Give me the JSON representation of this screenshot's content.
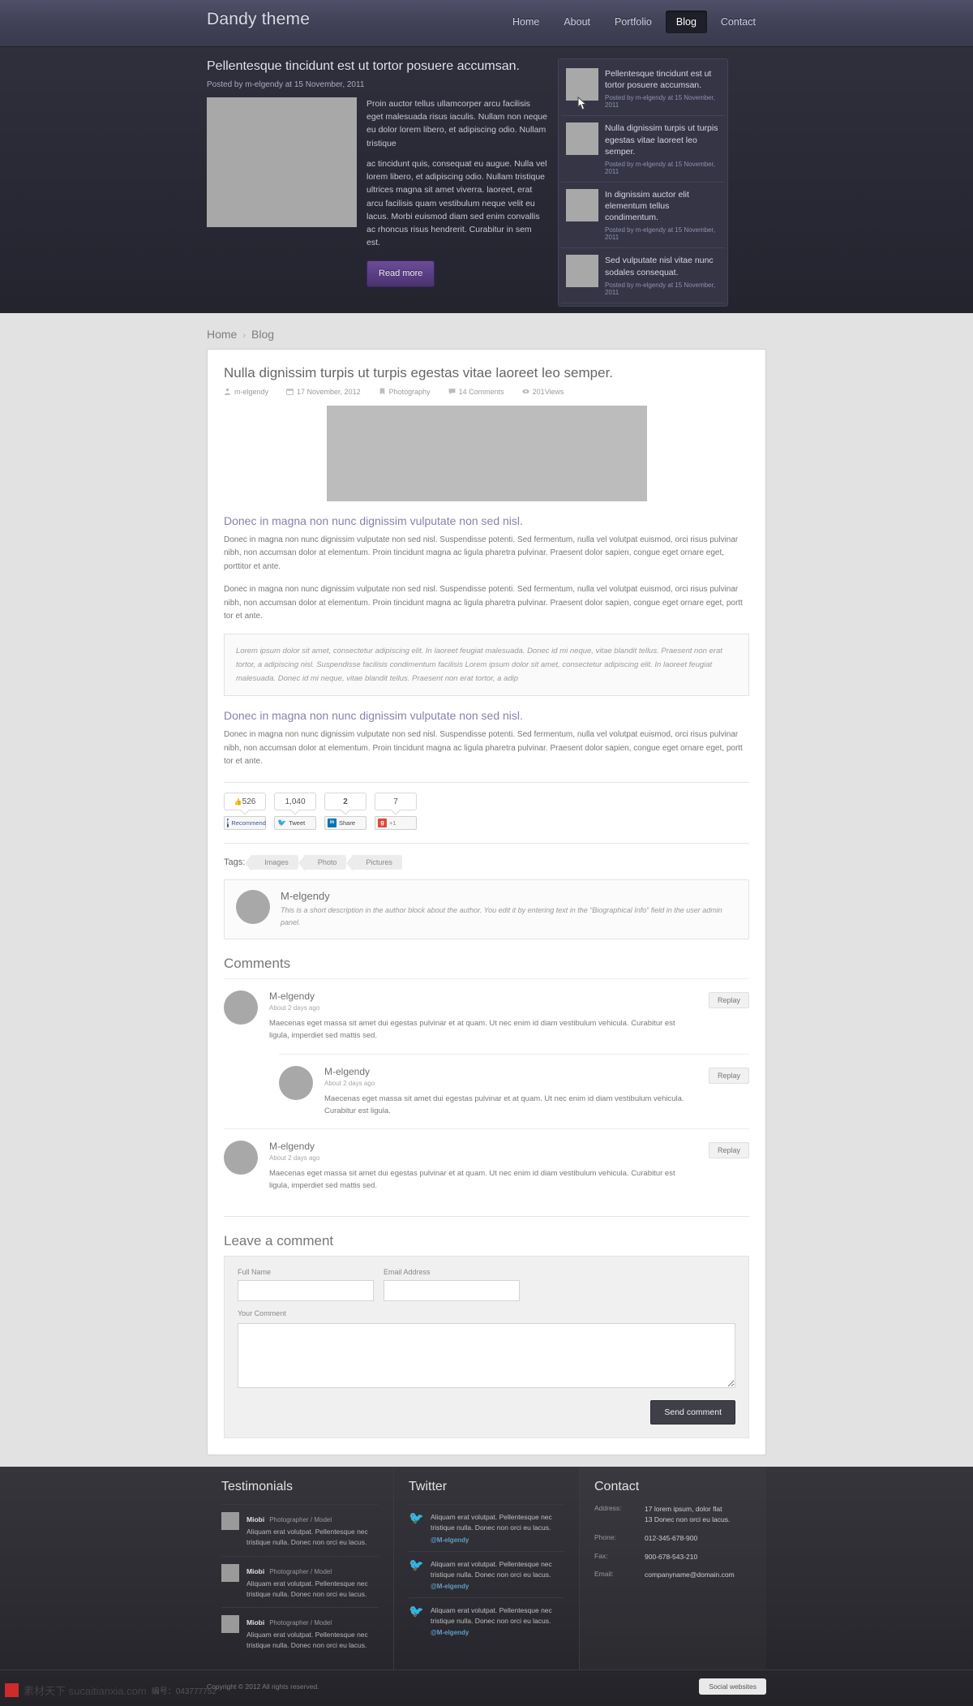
{
  "header": {
    "brand": "Dandy theme",
    "nav": [
      {
        "label": "Home",
        "active": false
      },
      {
        "label": "About",
        "active": false
      },
      {
        "label": "Portfolio",
        "active": false
      },
      {
        "label": "Blog",
        "active": true
      },
      {
        "label": "Contact",
        "active": false
      }
    ]
  },
  "slider": {
    "title": "Pellentesque tincidunt est ut tortor posuere accumsan.",
    "meta": "Posted by m-elgendy at 15 November, 2011",
    "paragraph1": "Proin auctor tellus ullamcorper arcu facilisis eget malesuada risus iaculis. Nullam non neque eu dolor lorem libero, et adipiscing odio. Nullam tristique",
    "paragraph2": "ac tincidunt quis, consequat eu augue. Nulla vel lorem libero, et adipiscing odio. Nullam tristique ultrices magna sit amet viverra. laoreet, erat arcu facilisis quam vestibulum neque velit eu lacus. Morbi euismod diam sed enim convallis ac rhoncus risus hendrerit. Curabitur in sem est.",
    "read_more": "Read more",
    "items": [
      {
        "title": "Pellentesque tincidunt est ut tortor posuere accumsan.",
        "meta": "Posted by m-elgendy at 15 November, 2011"
      },
      {
        "title": "Nulla dignissim turpis ut turpis egestas vitae laoreet leo semper.",
        "meta": "Posted by m-elgendy at 15 November, 2011"
      },
      {
        "title": "In dignissim auctor elit elementum tellus condimentum.",
        "meta": "Posted by m-elgendy at 15 November, 2011"
      },
      {
        "title": "Sed vulputate nisl vitae nunc sodales consequat.",
        "meta": "Posted by m-elgendy at 15 November, 2011"
      }
    ]
  },
  "breadcrumb": {
    "home": "Home",
    "separator": "›",
    "current": "Blog"
  },
  "post": {
    "title": "Nulla dignissim turpis ut turpis egestas vitae laoreet leo semper.",
    "meta": {
      "author": "m-elgendy",
      "date": "17 November, 2012",
      "category": "Photography",
      "comments": "14 Comments",
      "views": "201Views"
    },
    "heading1": "Donec in magna non nunc dignissim vulputate non sed nisl.",
    "body1": "Donec in magna non nunc dignissim vulputate non sed nisl. Suspendisse potenti. Sed fermentum, nulla vel volutpat euismod, orci risus pulvinar nibh, non accumsan  dolor at elementum. Proin tincidunt magna ac ligula pharetra pulvinar. Praesent dolor sapien, congue eget ornare eget, porttitor et ante.",
    "body2": "Donec in magna non nunc dignissim vulputate non sed nisl. Suspendisse potenti. Sed fermentum, nulla vel volutpat euismod, orci risus pulvinar nibh, non accumsan  dolor at elementum. Proin tincidunt magna ac ligula pharetra pulvinar. Praesent dolor sapien, congue eget ornare eget, portt tor et ante.",
    "quote": "Lorem ipsum dolor sit amet, consectetur adipiscing elit. In laoreet feugiat malesuada. Donec id mi neque, vitae blandit tellus. Praesent non erat tortor, a adipiscing nisl. Suspendisse facilisis condimentum facilisis Lorem ipsum dolor sit amet, consectetur adipiscing elit. In laoreet feugiat malesuada. Donec id mi neque, vitae blandit tellus. Praesent non erat tortor, a adip",
    "heading2": "Donec in magna non nunc dignissim vulputate non sed nisl.",
    "body3": "Donec in magna non nunc dignissim vulputate non sed nisl. Suspendisse potenti. Sed fermentum, nulla vel volutpat euismod, orci risus pulvinar nibh, non accumsan  dolor at elementum. Proin tincidunt magna ac ligula pharetra pulvinar. Praesent dolor sapien, congue eget ornare eget, portt tor et ante."
  },
  "share": {
    "facebook": {
      "count": "526",
      "label": "Recommend",
      "badge": "f",
      "color": "#3b5998"
    },
    "twitter": {
      "count": "1,040",
      "label": "Tweet",
      "badge": "t",
      "color": "#55acee"
    },
    "linkedin": {
      "count": "2",
      "label": "Share",
      "badge": "in",
      "color": "#0077b5"
    },
    "google": {
      "count": "7",
      "label": "+1",
      "badge": "g",
      "color": "#dd4b39"
    }
  },
  "tags": {
    "label": "Tags:",
    "items": [
      "Images",
      "Photo",
      "Pictures"
    ]
  },
  "author_box": {
    "name": "M-elgendy",
    "description": "This is a short description in the author block about the author. You edit it by entering text in the “Biographical Info” field in the user admin panel."
  },
  "comments": {
    "title": "Comments",
    "reply_label": "Replay",
    "items": [
      {
        "name": "M-elgendy",
        "time": "About 2 days ago",
        "text": "Maecenas eget massa sit amet dui egestas pulvinar et at quam. Ut nec enim id diam vestibulum vehicula. Curabitur est ligula, imperdiet sed mattis sed.",
        "nested": false
      },
      {
        "name": "M-elgendy",
        "time": "About 2 days ago",
        "text": "Maecenas eget massa sit amet dui egestas pulvinar et at quam. Ut nec enim id diam vestibulum vehicula. Curabitur est ligula.",
        "nested": true
      },
      {
        "name": "M-elgendy",
        "time": "About 2 days ago",
        "text": "Maecenas eget massa sit amet dui egestas pulvinar et at quam. Ut nec enim id diam vestibulum vehicula. Curabitur est ligula, imperdiet sed mattis sed.",
        "nested": false
      }
    ]
  },
  "comment_form": {
    "title": "Leave a comment",
    "name_label": "Full Name",
    "name_value": "",
    "email_label": "Email Address",
    "email_value": "",
    "comment_label": "Your Comment",
    "comment_value": "",
    "submit": "Send comment"
  },
  "footer": {
    "testimonials": {
      "title": "Testimonials",
      "items": [
        {
          "name": "Miobi",
          "role": "Photographer / Model",
          "text": "Aliquam erat volutpat. Pellentesque nec tristique nulla. Donec non orci eu lacus."
        },
        {
          "name": "Miobi",
          "role": "Photographer / Model",
          "text": "Aliquam erat volutpat. Pellentesque nec tristique nulla. Donec non orci eu lacus."
        },
        {
          "name": "Miobi",
          "role": "Photographer / Model",
          "text": "Aliquam erat volutpat. Pellentesque nec tristique nulla. Donec non orci eu lacus."
        }
      ]
    },
    "twitter": {
      "title": "Twitter",
      "items": [
        {
          "text": "Aliquam erat volutpat. Pellentesque nec tristique nulla. Donec non orci eu lacus.",
          "handle": "@M-elgendy"
        },
        {
          "text": "Aliquam erat volutpat. Pellentesque nec tristique nulla. Donec non orci eu lacus.",
          "handle": "@M-elgendy"
        },
        {
          "text": "Aliquam erat volutpat. Pellentesque nec tristique nulla. Donec non orci eu lacus.",
          "handle": "@M-elgendy"
        }
      ]
    },
    "contact": {
      "title": "Contact",
      "rows": [
        {
          "key": "Address:",
          "value": "17 lorem ipsum, dolor flat\n13 Donec non orci eu lacus."
        },
        {
          "key": "Phone:",
          "value": "012-345-678-900"
        },
        {
          "key": "Fax:",
          "value": "900-678-543-210"
        },
        {
          "key": "Email:",
          "value": "companyname@domain.com"
        }
      ]
    },
    "copyright": "Copyright © 2012 All rights reserved.",
    "social_button": "Social websites"
  },
  "watermark": {
    "site": "素材天下 sucaitianxia.com",
    "code": "编号：043777752"
  }
}
